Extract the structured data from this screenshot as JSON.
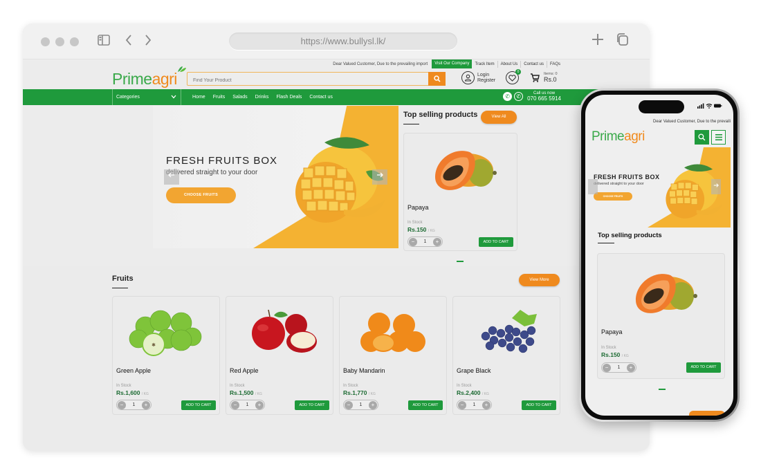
{
  "browser": {
    "url": "https://www.bullysl.lk/"
  },
  "colors": {
    "brand_green": "#1f9a3c",
    "accent_orange": "#ef8a1e",
    "hero_yellow": "#f4b232",
    "price_green": "#1d6b33"
  },
  "topbar": {
    "notice": "Dear Valued Customer, Due to the prevailing import",
    "links": [
      "Visit Our Company",
      "Track Item",
      "About Us",
      "Contact us",
      "FAQs"
    ]
  },
  "header": {
    "logo_part1": "Prime",
    "logo_part2": "agri",
    "search_placeholder": "Find Your Product",
    "login": "Login",
    "register": "Register",
    "wishlist_count": "0",
    "cart_items": "Items: 0",
    "cart_total": "Rs.0"
  },
  "nav": {
    "categories": "Categories",
    "links": [
      "Home",
      "Fruits",
      "Salads",
      "Drinks",
      "Flash Deals",
      "Contact us"
    ],
    "call_label": "Call us now",
    "phone": "070 665 5914"
  },
  "hero": {
    "title": "FRESH FRUITS BOX",
    "subtitle": "delivered straight to your door",
    "cta": "CHOOSE FRUITS"
  },
  "top_selling": {
    "title": "Top selling products",
    "view_all": "View All",
    "product": {
      "name": "Papaya",
      "stock": "In Stock",
      "price": "Rs.150",
      "unit": "/ KG",
      "qty": "1",
      "add_to_cart": "ADD TO CART"
    }
  },
  "fruits": {
    "title": "Fruits",
    "view_more": "View More",
    "products": [
      {
        "name": "Green Apple",
        "stock": "In Stock",
        "price": "Rs.1,600",
        "unit": "/ KG",
        "qty": "1",
        "add_to_cart": "ADD TO CART"
      },
      {
        "name": "Red Apple",
        "stock": "In Stock",
        "price": "Rs.1,500",
        "unit": "/ KG",
        "qty": "1",
        "add_to_cart": "ADD TO CART"
      },
      {
        "name": "Baby Mandarin",
        "stock": "In Stock",
        "price": "Rs.1,770",
        "unit": "/ KG",
        "qty": "1",
        "add_to_cart": "ADD TO CART"
      },
      {
        "name": "Grape Black",
        "stock": "In Stock",
        "price": "Rs.2,400",
        "unit": "/ KG",
        "qty": "1",
        "add_to_cart": "ADD TO CART"
      }
    ]
  },
  "mobile": {
    "notice": "Dear Valued Customer, Due to the prevaili"
  }
}
